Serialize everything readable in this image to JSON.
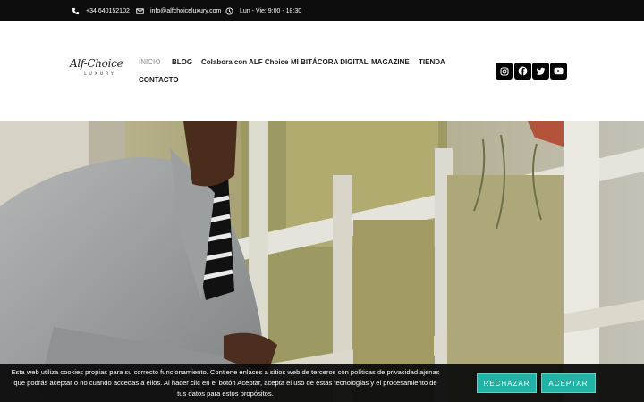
{
  "topbar": {
    "phone": "+34 640152102",
    "email": "info@alfchoiceluxury.com",
    "hours": "Lun - Vie: 9:00 - 18:30"
  },
  "logo": {
    "script": "Alf-Choice",
    "sub": "LUXURY"
  },
  "nav": {
    "items": [
      "INICIO",
      "BLOG",
      "Colabora con ALF Choice",
      "MI BITÁCORA DIGITAL",
      "MAGAZINE",
      "TIENDA",
      "CONTACTO"
    ],
    "active": "INICIO"
  },
  "social": {
    "icons": [
      "instagram-icon",
      "facebook-icon",
      "twitter-icon",
      "youtube-icon"
    ]
  },
  "cookie": {
    "text": "Esta web utiliza cookies propias para su correcto funcionamiento. Contiene enlaces a sitios web de terceros con políticas de privacidad ajenas que podrás aceptar o no cuando accedas a ellos. Al hacer clic en el botón Aceptar, acepta el uso de estas tecnologías y el procesamiento de tus datos para estos propósitos.",
    "reject_label": "RECHAZAR",
    "accept_label": "ACEPTAR"
  },
  "colors": {
    "topbar_bg": "#0d0d0d",
    "accent": "#1fb5a6",
    "nav_active": "#8a8a8a"
  }
}
